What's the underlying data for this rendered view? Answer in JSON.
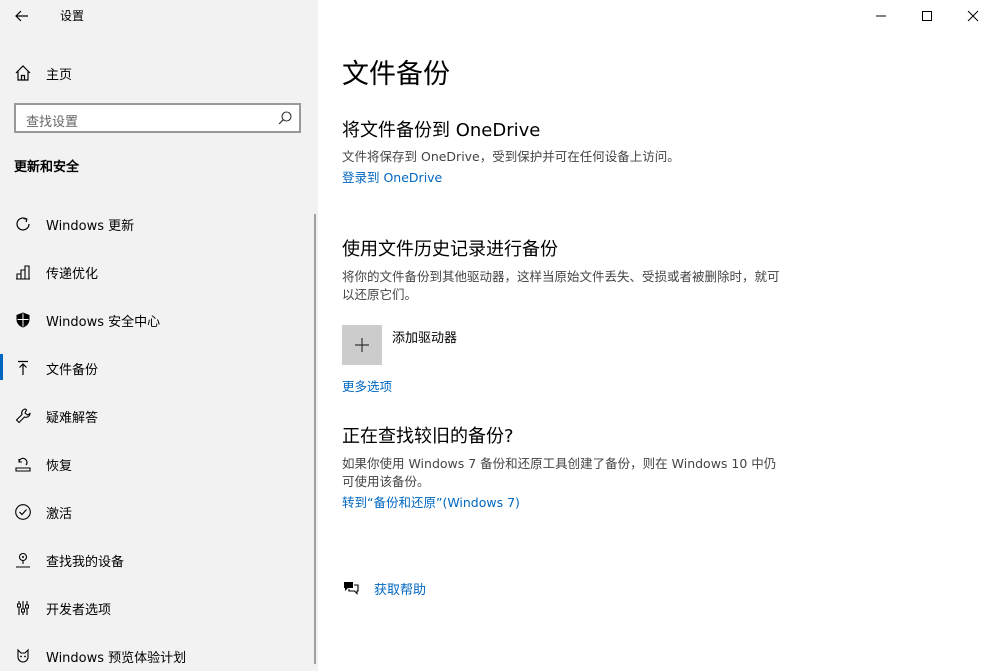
{
  "window": {
    "title": "设置"
  },
  "sidebar": {
    "home_label": "主页",
    "search_placeholder": "查找设置",
    "section_title": "更新和安全",
    "items": [
      {
        "label": "Windows 更新",
        "icon": "sync-icon"
      },
      {
        "label": "传递优化",
        "icon": "delivery-icon"
      },
      {
        "label": "Windows 安全中心",
        "icon": "shield-icon"
      },
      {
        "label": "文件备份",
        "icon": "backup-icon",
        "active": true
      },
      {
        "label": "疑难解答",
        "icon": "wrench-icon"
      },
      {
        "label": "恢复",
        "icon": "recovery-icon"
      },
      {
        "label": "激活",
        "icon": "check-circle-icon"
      },
      {
        "label": "查找我的设备",
        "icon": "find-device-icon"
      },
      {
        "label": "开发者选项",
        "icon": "developer-icon"
      },
      {
        "label": "Windows 预览体验计划",
        "icon": "insider-icon"
      }
    ]
  },
  "main": {
    "page_title": "文件备份",
    "onedrive": {
      "heading": "将文件备份到 OneDrive",
      "description": "文件将保存到 OneDrive，受到保护并可在任何设备上访问。",
      "link": "登录到 OneDrive"
    },
    "history": {
      "heading": "使用文件历史记录进行备份",
      "description": "将你的文件备份到其他驱动器，这样当原始文件丢失、受损或者被删除时，就可以还原它们。",
      "add_drive_label": "添加驱动器",
      "more_options_link": "更多选项"
    },
    "older": {
      "heading": "正在查找较旧的备份?",
      "description": "如果你使用 Windows 7 备份和还原工具创建了备份，则在 Windows 10 中仍可使用该备份。",
      "link": "转到“备份和还原”(Windows 7)"
    },
    "help_label": "获取帮助"
  },
  "colors": {
    "accent": "#0067c0",
    "sidebar_bg": "#f2f2f2"
  }
}
